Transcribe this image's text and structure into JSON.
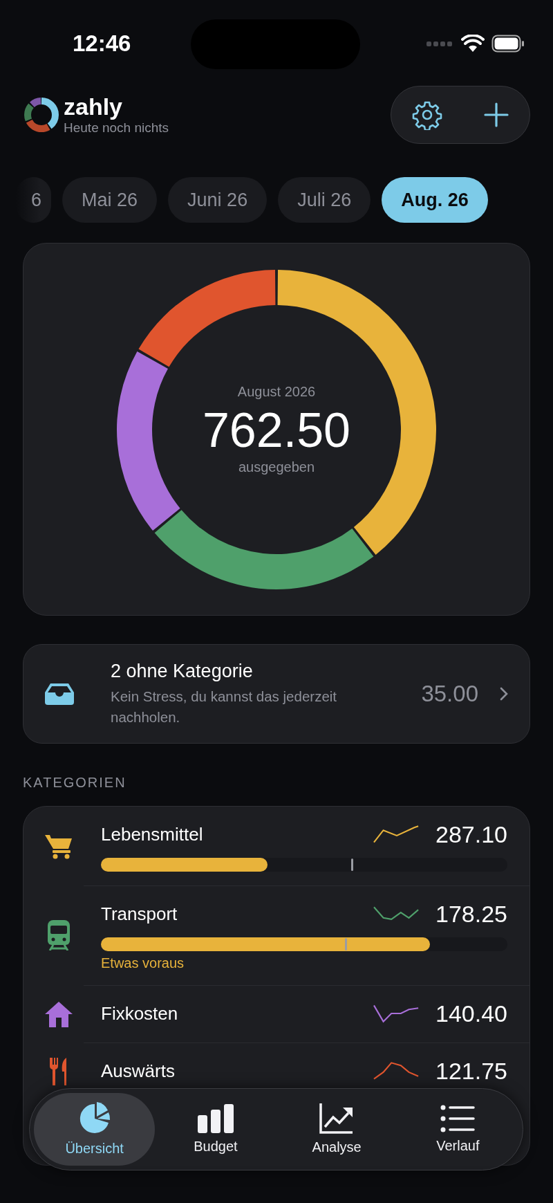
{
  "status_bar": {
    "time": "12:46"
  },
  "header": {
    "app_name": "zahly",
    "subtitle": "Heute noch nichts"
  },
  "months": [
    {
      "label": "6",
      "selected": false
    },
    {
      "label": "Mai 26",
      "selected": false
    },
    {
      "label": "Juni 26",
      "selected": false
    },
    {
      "label": "Juli 26",
      "selected": false
    },
    {
      "label": "Aug. 26",
      "selected": true
    }
  ],
  "summary": {
    "period": "August 2026",
    "total": "762.50",
    "caption": "ausgegeben"
  },
  "uncategorized": {
    "title": "2 ohne Kategorie",
    "subtitle": "Kein Stress, du kannst das jederzeit nachholen.",
    "amount": "35.00"
  },
  "section_title": "KATEGORIEN",
  "categories": [
    {
      "name": "Lebensmittel",
      "amount": "287.10",
      "color": "#e8b33b",
      "budget": {
        "level": 0.41,
        "color": "#e8b33b",
        "marker": {
          "level": 0.615
        }
      }
    },
    {
      "name": "Transport",
      "amount": "178.25",
      "color": "#4fa06b",
      "budget": {
        "level": 0.81,
        "color": "#e8b33b",
        "marker": {
          "level": 0.6
        }
      },
      "note": "Etwas voraus"
    },
    {
      "name": "Fixkosten",
      "amount": "140.40",
      "color": "#a86fd9"
    },
    {
      "name": "Auswärts",
      "amount": "121.75",
      "color": "#e0552e"
    }
  ],
  "tabs": [
    {
      "label": "Übersicht",
      "selected": true
    },
    {
      "label": "Budget",
      "selected": false
    },
    {
      "label": "Analyse",
      "selected": false
    },
    {
      "label": "Verlauf",
      "selected": false
    }
  ]
}
